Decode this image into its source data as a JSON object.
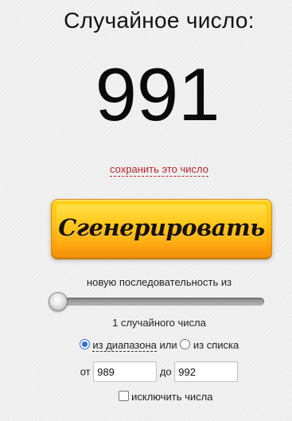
{
  "header": {
    "title": "Случайное число:"
  },
  "result": {
    "value": "991",
    "save_link": "сохранить это число"
  },
  "generate_button": {
    "label": "Сгенерировать",
    "color": "#ffbf12"
  },
  "sequence": {
    "label": "новую последовательность из",
    "slider_level": 0,
    "count_label": "1 случайного числа"
  },
  "mode": {
    "range_label": "из диапазона",
    "or_label": "или",
    "list_label": "из списка",
    "selected": "range"
  },
  "range": {
    "from_label": "от",
    "from_value": "989",
    "to_label": "до",
    "to_value": "992"
  },
  "exclude": {
    "label": "исключить числа",
    "checked": false
  },
  "colors": {
    "link": "#b3262a",
    "radio_selected": "#2f6fd6"
  }
}
